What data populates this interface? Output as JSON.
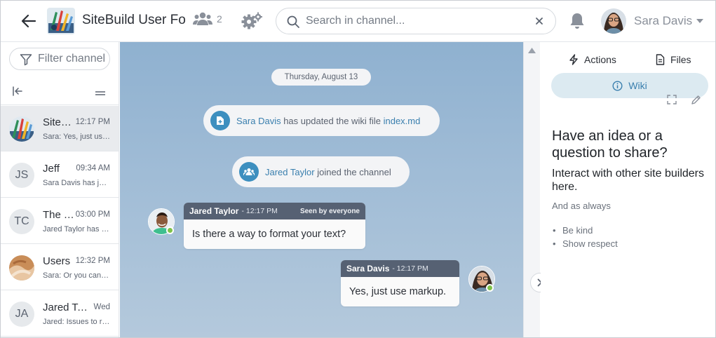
{
  "header": {
    "channel_title": "SiteBuild User Forum",
    "members_count": "2",
    "search": {
      "placeholder": "Search in channel..."
    },
    "user": {
      "name": "Sara Davis"
    }
  },
  "sidebar": {
    "filter": {
      "placeholder": "Filter channels"
    },
    "rooms": [
      {
        "name": "SiteBuild User Forum",
        "time": "12:17 PM",
        "preview": "Sara: Yes, just use markup.",
        "initials": ""
      },
      {
        "name": "Jeff",
        "time": "09:34 AM",
        "preview": "Sara Davis has joined",
        "initials": "JS"
      },
      {
        "name": "The Team",
        "time": "03:00 PM",
        "preview": "Jared Taylor has joined",
        "initials": "TC"
      },
      {
        "name": "Users",
        "time": "12:32 PM",
        "preview": "Sara: Or you can try",
        "initials": ""
      },
      {
        "name": "Jared Taylor",
        "time": "Wed",
        "preview": "Jared: Issues to resolve",
        "initials": "JA"
      }
    ]
  },
  "chat": {
    "date": "Thursday, August 13",
    "system": [
      {
        "actor": "Sara Davis",
        "text": "has updated the wiki file",
        "target": "index.md"
      },
      {
        "actor": "Jared Taylor",
        "text": "joined the channel"
      }
    ],
    "messages": [
      {
        "author": "Jared Taylor",
        "time": "- 12:17 PM",
        "seen": "Seen by everyone",
        "text": "Is there a way to format your text?"
      },
      {
        "author": "Sara Davis",
        "time": "- 12:17 PM",
        "text": "Yes, just use markup."
      }
    ]
  },
  "panel": {
    "tabs": {
      "actions": "Actions",
      "files": "Files",
      "wiki": "Wiki"
    },
    "wiki": {
      "heading": "Have an idea or a question to share?",
      "subheading": "Interact with other site builders here.",
      "paragraph": "And as always",
      "list": [
        "Be kind",
        "Show respect"
      ]
    }
  },
  "colors": {
    "accent": "#3a7fae",
    "bubble_header": "#566173",
    "online": "#7ec24a",
    "chat_bg": "#a0bcd6"
  },
  "icons": [
    "back-arrow-icon",
    "users-icon",
    "gears-icon",
    "search-icon",
    "close-icon",
    "bell-icon",
    "caret-down-icon",
    "filter-icon",
    "collapse-left-icon",
    "menu-icon",
    "file-icon",
    "people-icon",
    "chevron-right-icon",
    "bolt-icon",
    "info-icon",
    "fullscreen-icon",
    "pencil-icon"
  ]
}
